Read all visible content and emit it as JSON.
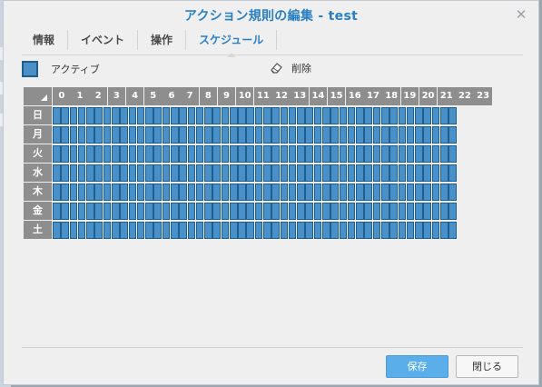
{
  "dialog": {
    "title": "アクション規則の編集 - test",
    "close_icon": "close-icon"
  },
  "tabs": [
    {
      "label": "情報",
      "active": false
    },
    {
      "label": "イベント",
      "active": false
    },
    {
      "label": "操作",
      "active": false
    },
    {
      "label": "スケジュール",
      "active": true
    }
  ],
  "toolbar": {
    "active_label": "アクティブ",
    "delete_label": "削除",
    "delete_icon": "eraser-icon"
  },
  "schedule": {
    "hours": [
      "0",
      "1",
      "2",
      "3",
      "4",
      "5",
      "6",
      "7",
      "8",
      "9",
      "10",
      "11",
      "12",
      "13",
      "14",
      "15",
      "16",
      "17",
      "18",
      "19",
      "20",
      "21",
      "22",
      "23"
    ],
    "days": [
      "日",
      "月",
      "火",
      "水",
      "木",
      "金",
      "土"
    ],
    "slots_per_hour": 2,
    "all_active": true,
    "active_color": "#4a90c8"
  },
  "footer": {
    "save_label": "保存",
    "close_label": "閉じる"
  }
}
